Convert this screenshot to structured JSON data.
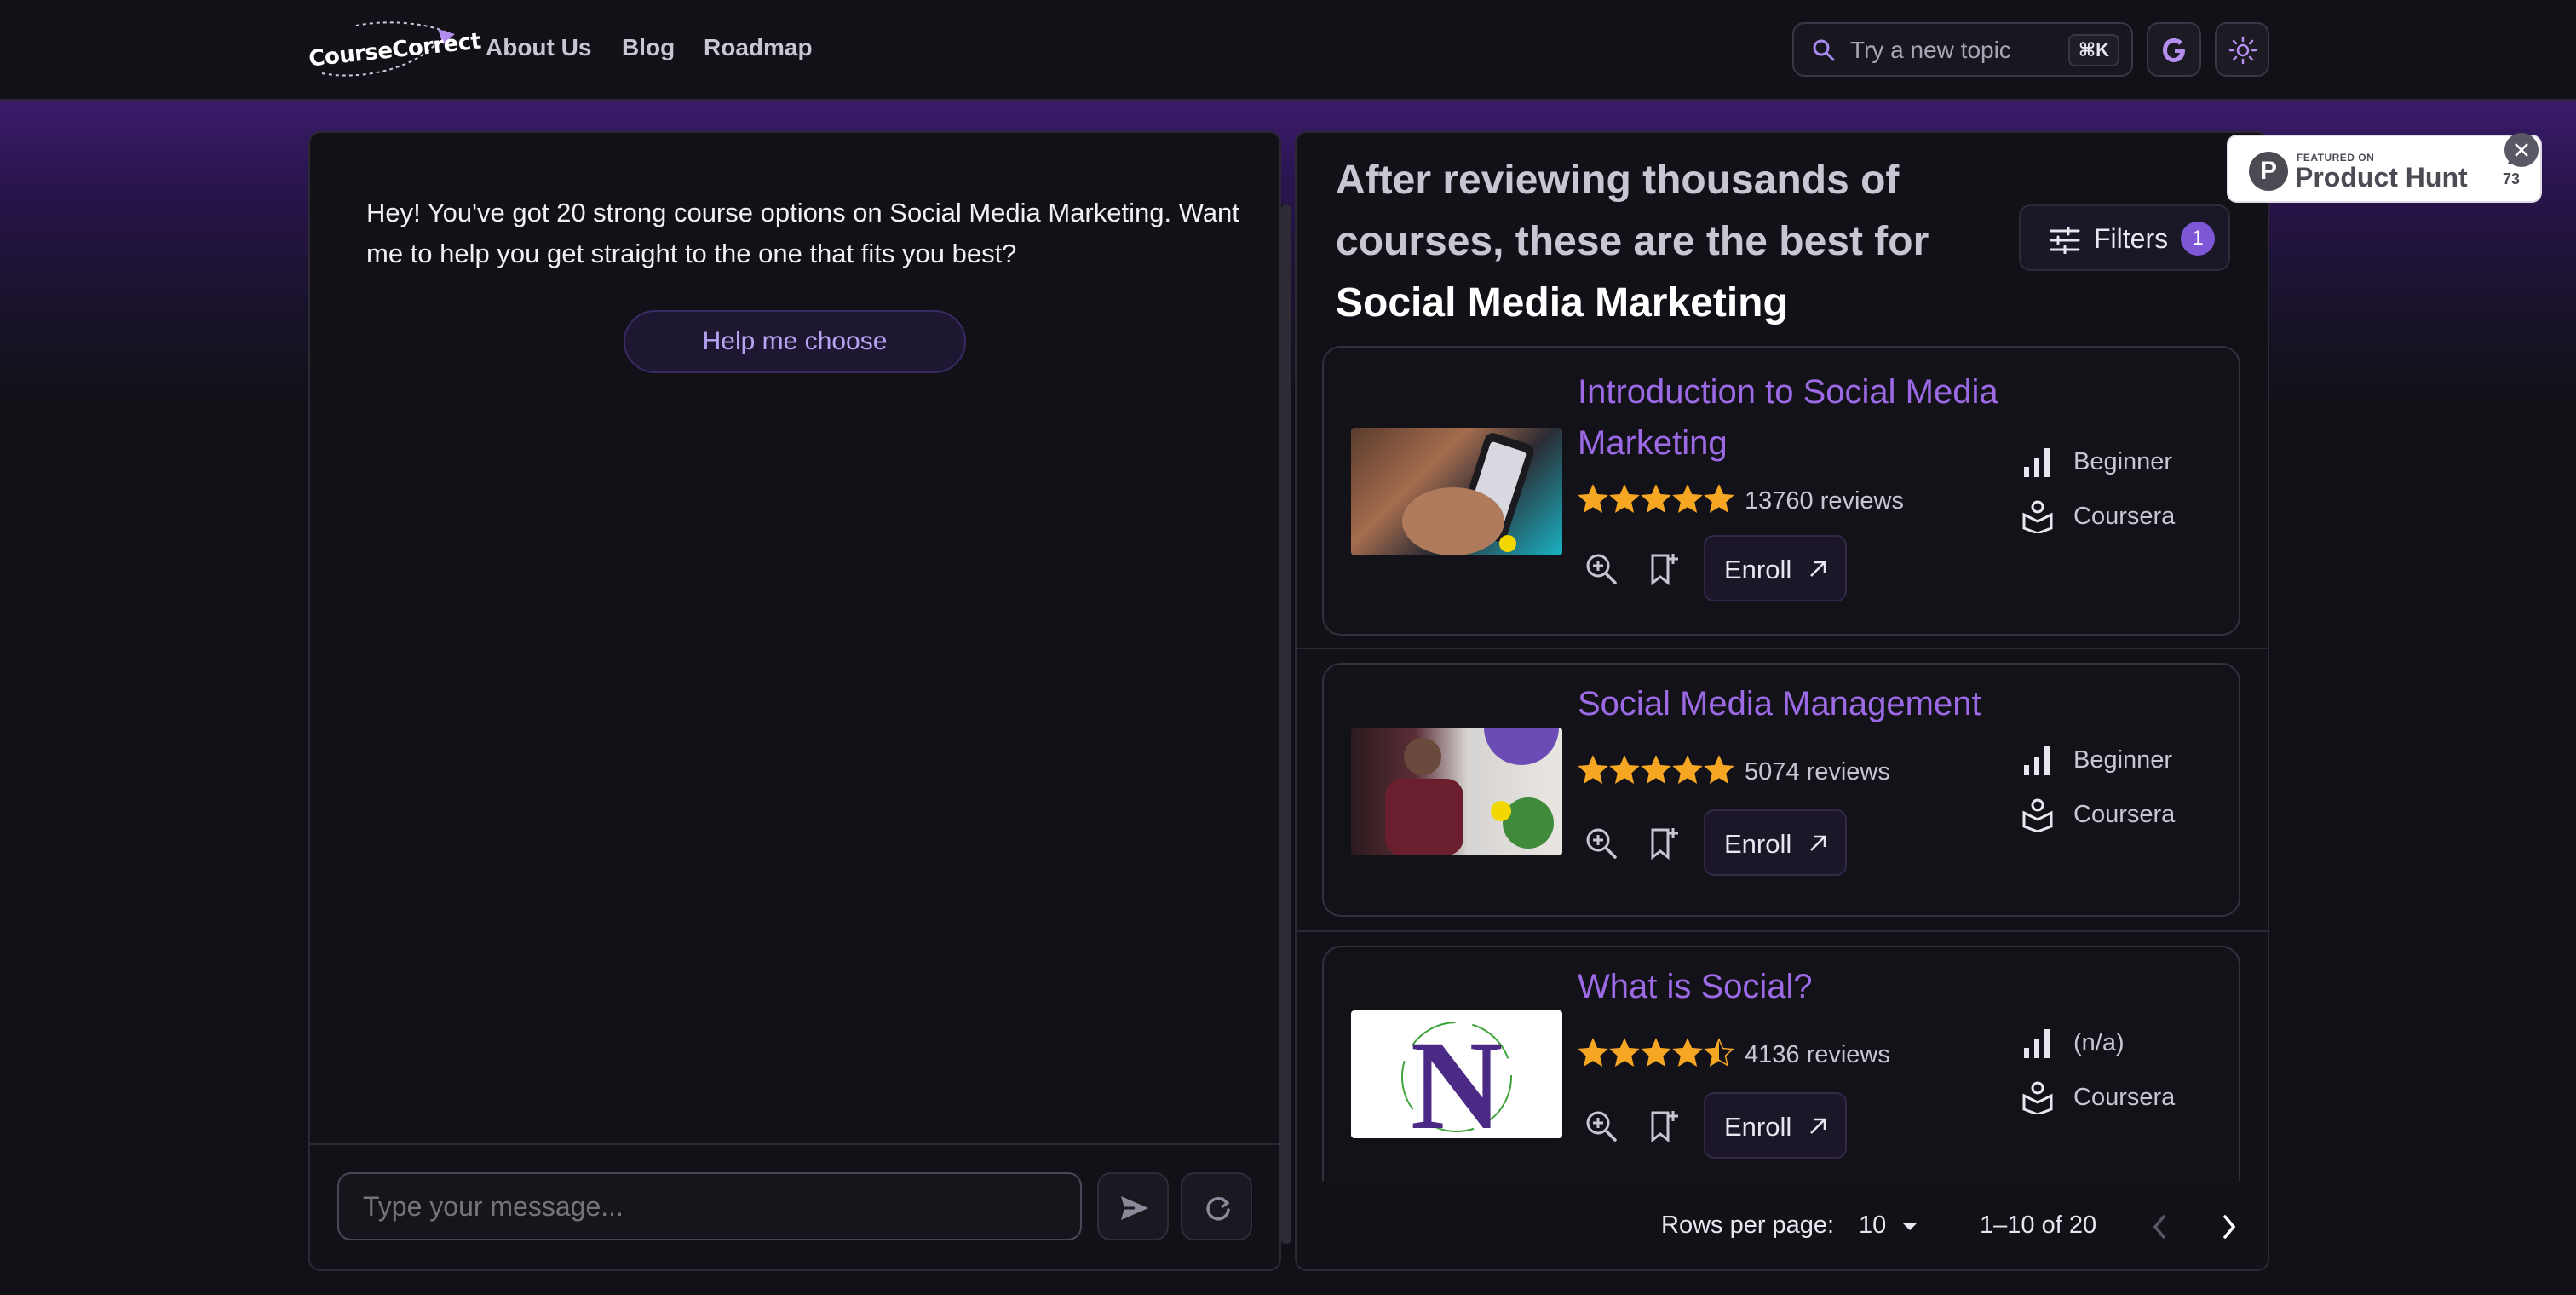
{
  "navbar": {
    "logo_text": "CourseCorrect",
    "links": [
      "About Us",
      "Blog",
      "Roadmap"
    ],
    "search_placeholder": "Try a new topic",
    "search_shortcut": "⌘K",
    "google_label": "G"
  },
  "chat": {
    "message": "Hey! You've got 20 strong course options on Social Media Marketing. Want me to help you get straight to the one that fits you best?",
    "help_button": "Help me choose",
    "input_placeholder": "Type your message..."
  },
  "results": {
    "title_prefix": "After reviewing thousands of courses, these are the best for ",
    "title_topic": "Social Media Marketing",
    "filters_label": "Filters",
    "filters_count": "1",
    "enroll_label": "Enroll",
    "courses": [
      {
        "title": "Introduction to Social Media Marketing",
        "rating": 5,
        "reviews": "13760 reviews",
        "level": "Beginner",
        "provider": "Coursera"
      },
      {
        "title": "Social Media Management",
        "rating": 5,
        "reviews": "5074 reviews",
        "level": "Beginner",
        "provider": "Coursera"
      },
      {
        "title": "What is Social?",
        "rating": 4.5,
        "reviews": "4136 reviews",
        "level": "(n/a)",
        "provider": "Coursera"
      }
    ],
    "pagination": {
      "rows_label": "Rows per page:",
      "rows_value": "10",
      "range": "1–10 of 20"
    }
  },
  "product_hunt": {
    "featured_on": "FEATURED ON",
    "name": "Product Hunt",
    "count": "73"
  },
  "colors": {
    "accent": "#9d6ae6",
    "star": "#f5a623",
    "background": "#121016"
  }
}
